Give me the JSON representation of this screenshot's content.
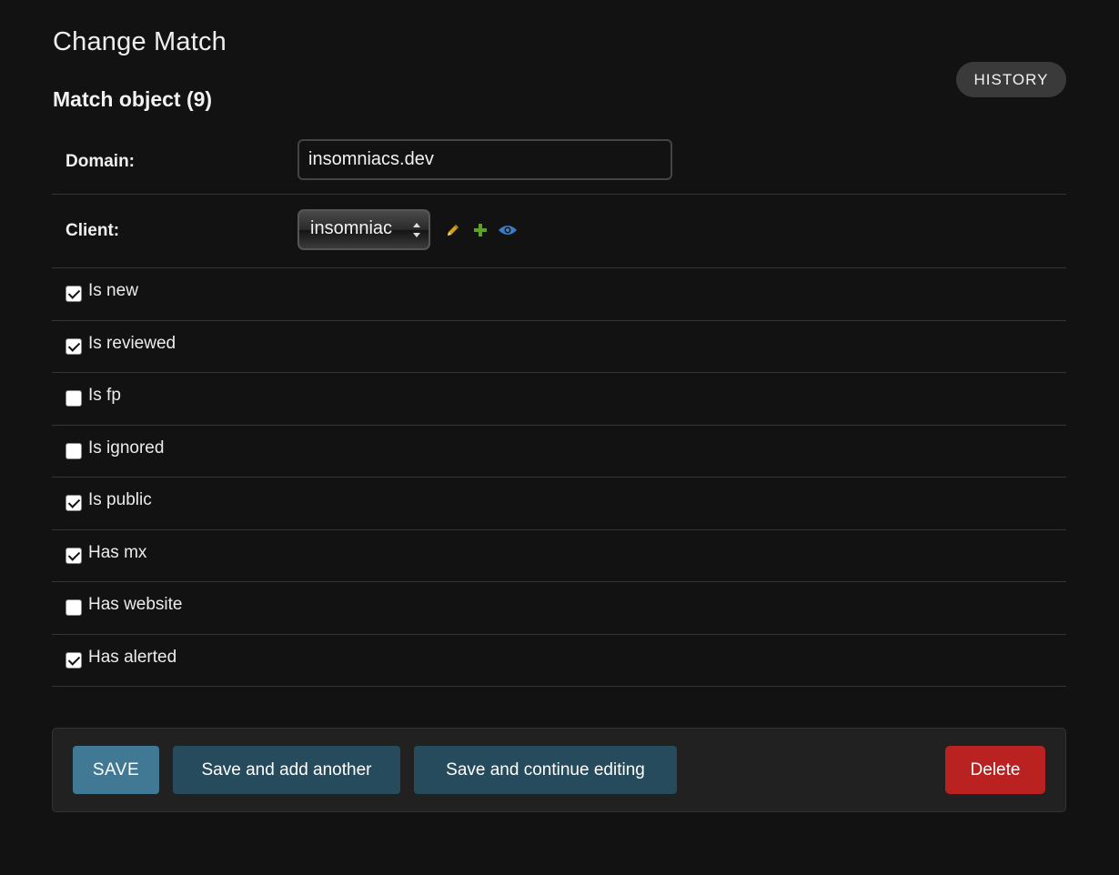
{
  "page": {
    "title": "Change Match",
    "history_label": "HISTORY"
  },
  "object": {
    "title": "Match object (9)"
  },
  "fields": {
    "domain": {
      "label": "Domain:",
      "value": "insomniacs.dev"
    },
    "client": {
      "label": "Client:",
      "selected": "insomniac",
      "actions": {
        "change_icon": "pencil-icon",
        "add_icon": "plus-icon",
        "view_icon": "eye-icon"
      }
    }
  },
  "checkboxes": [
    {
      "label": "Is new",
      "checked": true
    },
    {
      "label": "Is reviewed",
      "checked": true
    },
    {
      "label": "Is fp",
      "checked": false
    },
    {
      "label": "Is ignored",
      "checked": false
    },
    {
      "label": "Is public",
      "checked": true
    },
    {
      "label": "Has mx",
      "checked": true
    },
    {
      "label": "Has website",
      "checked": false
    },
    {
      "label": "Has alerted",
      "checked": true
    }
  ],
  "actions": {
    "save": "SAVE",
    "save_add": "Save and add another",
    "save_continue": "Save and continue editing",
    "delete": "Delete"
  },
  "colors": {
    "background": "#121212",
    "save": "#417893",
    "secondary": "#264b5d",
    "delete": "#ba2121",
    "pencil": "#d4a017",
    "plus": "#5fa225",
    "eye": "#3c7ec6"
  }
}
